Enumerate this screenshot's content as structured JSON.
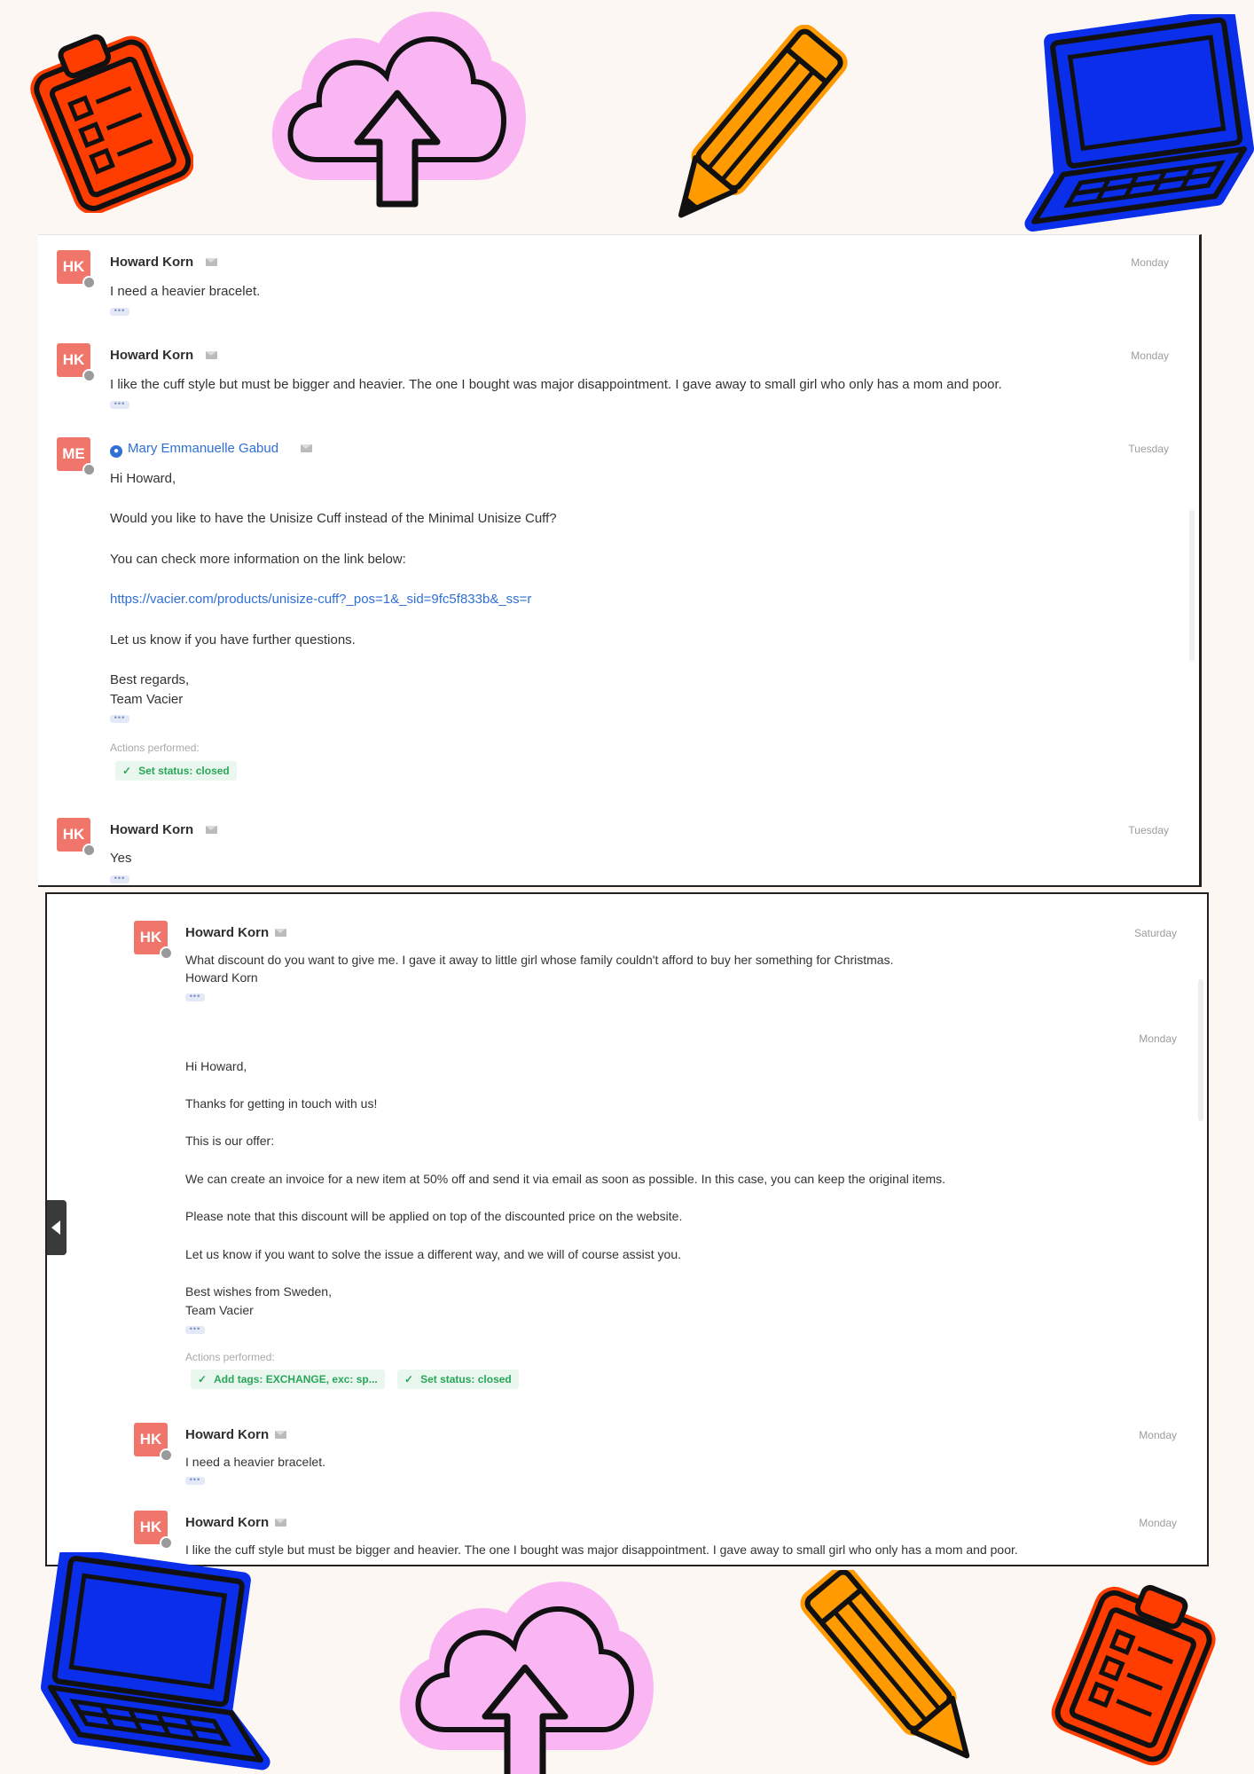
{
  "panel1": {
    "messages": [
      {
        "initials": "HK",
        "name": "Howard Korn",
        "day": "Monday",
        "lines": [
          "I need a heavier bracelet."
        ]
      },
      {
        "initials": "HK",
        "name": "Howard Korn",
        "day": "Monday",
        "lines": [
          "I like the cuff style but must be bigger and heavier. The one I bought was major disappointment. I gave away to small girl who only has a mom and poor."
        ]
      },
      {
        "initials": "ME",
        "name": "Mary Emmanuelle Gabud",
        "day": "Tuesday",
        "lines": [
          "Hi Howard,",
          "Would you like to have the Unisize Cuff instead of the Minimal Unisize Cuff?",
          "You can check more information on the link below:",
          "https://vacier.com/products/unisize-cuff?_pos=1&_sid=9fc5f833b&_ss=r",
          "Let us know if you have further questions.",
          "Best regards,",
          "Team Vacier"
        ],
        "actions_label": "Actions performed:",
        "tags": [
          "Set status: closed"
        ]
      },
      {
        "initials": "HK",
        "name": "Howard Korn",
        "day": "Tuesday",
        "lines": [
          "Yes"
        ]
      }
    ],
    "more": "•••"
  },
  "panel2": {
    "messages": [
      {
        "initials": "HK",
        "name": "Howard Korn",
        "day": "Saturday",
        "lines": [
          "What discount do you want to give me. I gave it away to little girl whose family couldn't afford to buy her something for Christmas.",
          "Howard Korn"
        ]
      },
      {
        "day": "Monday",
        "lines": [
          "Hi Howard,",
          "Thanks for getting in touch with us!",
          "This is our offer:",
          "We can create an invoice for a new item at 50% off and send it via email as soon as possible. In this case, you can keep the original items.",
          "Please note that this discount will be applied on top of the discounted price on the website.",
          "Let us know if you want to solve the issue a different way, and we will of course assist you.",
          "Best wishes from Sweden,",
          "Team Vacier"
        ],
        "actions_label": "Actions performed:",
        "tags": [
          "Add tags: EXCHANGE, exc: sp...",
          "Set status: closed"
        ]
      },
      {
        "initials": "HK",
        "name": "Howard Korn",
        "day": "Monday",
        "lines": [
          "I need a heavier bracelet."
        ]
      },
      {
        "initials": "HK",
        "name": "Howard Korn",
        "day": "Monday",
        "lines": [
          "I like the cuff style but must be bigger and heavier. The one I bought was major disappointment. I gave away to small girl who only has a mom and poor."
        ]
      }
    ]
  },
  "icons": [
    "clipboard-icon",
    "cloud-upload-icon",
    "pencil-icon",
    "laptop-icon"
  ],
  "colors": {
    "clipboard": "#ff3d00",
    "cloud": "#f9b6f3",
    "pencil": "#ff9a00",
    "laptop": "#0a2eea",
    "avatar": "#f0766c",
    "link": "#2f6fd6",
    "tag_green": "#29a65a"
  }
}
